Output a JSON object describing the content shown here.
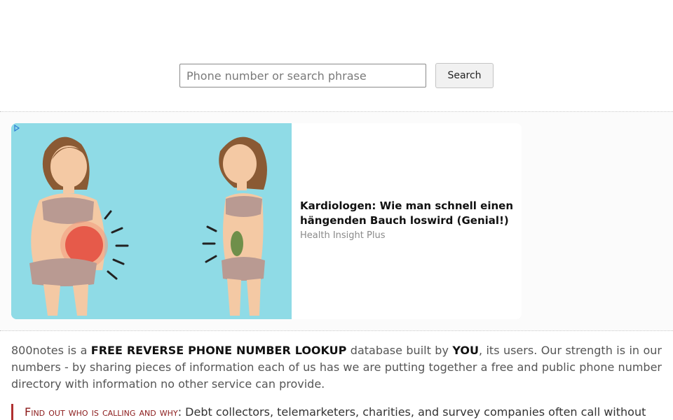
{
  "search": {
    "placeholder": "Phone number or search phrase",
    "value": "",
    "button_label": "Search"
  },
  "ad": {
    "headline": "Kardiologen: Wie man schnell einen hängenden Bauch loswird (Genial!)",
    "source": "Health Insight Plus",
    "adchoices_icon": "adchoices-triangle-icon"
  },
  "intro": {
    "p1": "800notes is a ",
    "b1": "FREE REVERSE PHONE NUMBER LOOKUP",
    "p2": " database built by ",
    "b2": "YOU",
    "p3": ", its users. Our strength is in our numbers - by sharing pieces of information each of us has we are putting together a free and public phone number directory with information no other service can provide."
  },
  "callout": {
    "title": "Find out who is calling and why",
    "separator": ":",
    "text": " Debt collectors, telemarketers, charities, and survey companies often call without"
  },
  "colors": {
    "accent": "#b03030",
    "ad_bg": "#8fdbe6"
  }
}
